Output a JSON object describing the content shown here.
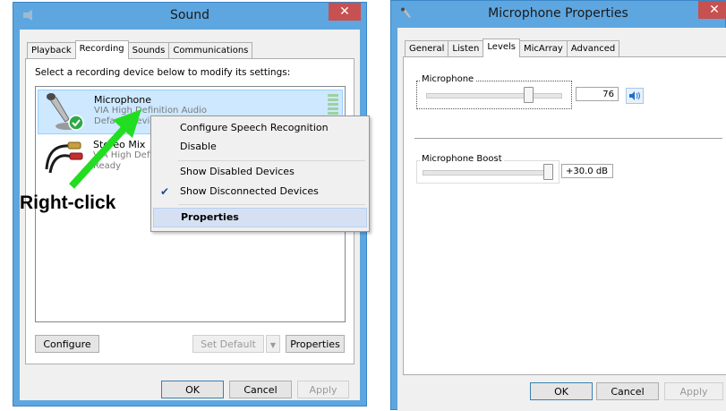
{
  "sound_window": {
    "title": "Sound",
    "tabs": [
      "Playback",
      "Recording",
      "Sounds",
      "Communications"
    ],
    "active_tab": "Recording",
    "instruction": "Select a recording device below to modify its settings:",
    "devices": [
      {
        "name": "Microphone",
        "driver": "VIA High Definition Audio",
        "status": "Default Device"
      },
      {
        "name": "Stereo Mix",
        "driver": "VIA High Definition Audio",
        "status": "Ready"
      }
    ],
    "buttons": {
      "configure": "Configure",
      "set_default": "Set Default",
      "properties": "Properties",
      "ok": "OK",
      "cancel": "Cancel",
      "apply": "Apply"
    }
  },
  "context_menu": {
    "items": [
      "Configure Speech Recognition",
      "Disable",
      "Show Disabled Devices",
      "Show Disconnected Devices",
      "Properties"
    ]
  },
  "annotation": {
    "text": "Right-click",
    "arrow_color": "#22dd22"
  },
  "mic_properties": {
    "title": "Microphone Properties",
    "tabs": [
      "General",
      "Listen",
      "Levels",
      "MicArray",
      "Advanced"
    ],
    "active_tab": "Levels",
    "microphone": {
      "label": "Microphone",
      "value": "76",
      "level": 0.76
    },
    "boost": {
      "label": "Microphone Boost",
      "value": "+30.0 dB",
      "level": 1.0
    },
    "buttons": {
      "ok": "OK",
      "cancel": "Cancel",
      "apply": "Apply"
    }
  },
  "colors": {
    "title_bar": "#5ea6df",
    "close_button": "#c75050",
    "selection": "#cde8ff"
  }
}
